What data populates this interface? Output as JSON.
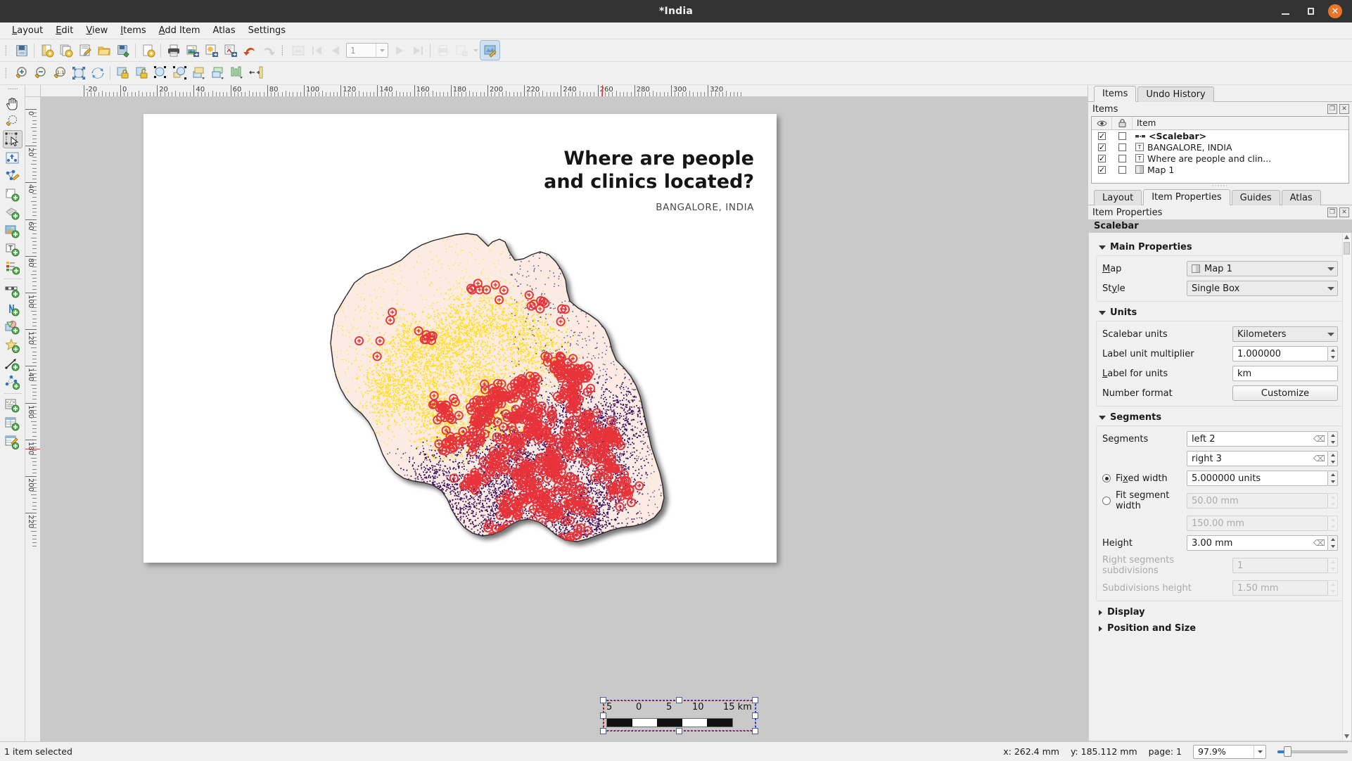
{
  "window": {
    "title": "*India",
    "minimize": "minimize",
    "maximize": "maximize",
    "close": "close"
  },
  "menubar": {
    "items": [
      {
        "label": "Layout",
        "mnemonic": "L"
      },
      {
        "label": "Edit",
        "mnemonic": "E"
      },
      {
        "label": "View",
        "mnemonic": "V"
      },
      {
        "label": "Items",
        "mnemonic": "I"
      },
      {
        "label": "Add Item",
        "mnemonic": "A"
      },
      {
        "label": "Atlas",
        "mnemonic": "A"
      },
      {
        "label": "Settings",
        "mnemonic": "S"
      }
    ]
  },
  "toolbar_layout": {
    "buttons": [
      {
        "name": "save-project-icon",
        "tip": "Save Project"
      },
      {
        "name": "new-layout-icon",
        "tip": "New Layout"
      },
      {
        "name": "duplicate-layout-icon",
        "tip": "Duplicate Layout"
      },
      {
        "name": "layout-manager-icon",
        "tip": "Layout Manager"
      },
      {
        "name": "open-folder-icon",
        "tip": "Layouts"
      },
      {
        "name": "save-layout-icon",
        "tip": "Save as Template"
      },
      {
        "name": "add-pages-icon",
        "tip": "Layout Properties"
      },
      {
        "name": "print-icon",
        "tip": "Print Layout"
      },
      {
        "name": "export-image-icon",
        "tip": "Export as Image"
      },
      {
        "name": "export-svg-icon",
        "tip": "Export as SVG"
      },
      {
        "name": "export-pdf-icon",
        "tip": "Export as PDF"
      },
      {
        "name": "undo-icon",
        "tip": "Undo"
      },
      {
        "name": "redo-icon",
        "tip": "Redo"
      }
    ],
    "atlas_buttons": [
      {
        "name": "atlas-preview-icon",
        "tip": "Preview Atlas"
      },
      {
        "name": "atlas-first-icon",
        "tip": "First feature"
      },
      {
        "name": "atlas-prev-icon",
        "tip": "Previous feature"
      },
      {
        "name": "atlas-next-icon",
        "tip": "Next feature"
      },
      {
        "name": "atlas-last-icon",
        "tip": "Last feature"
      },
      {
        "name": "atlas-print-icon",
        "tip": "Print Atlas"
      },
      {
        "name": "atlas-export-icon",
        "tip": "Export Atlas"
      },
      {
        "name": "atlas-settings-icon",
        "tip": "Atlas Settings"
      }
    ],
    "atlas_page_value": "1"
  },
  "toolbar_nav": {
    "buttons": [
      {
        "name": "zoom-in-icon",
        "tip": "Zoom In"
      },
      {
        "name": "zoom-out-icon",
        "tip": "Zoom Out"
      },
      {
        "name": "zoom-100-icon",
        "tip": "Zoom to 100%"
      },
      {
        "name": "zoom-full-icon",
        "tip": "Zoom Full"
      },
      {
        "name": "refresh-icon",
        "tip": "Refresh View"
      },
      {
        "name": "lock-items-icon",
        "tip": "Lock Selected Items"
      },
      {
        "name": "unlock-items-icon",
        "tip": "Unlock All Items"
      },
      {
        "name": "group-items-icon",
        "tip": "Group Items"
      },
      {
        "name": "ungroup-items-icon",
        "tip": "Ungroup Items"
      },
      {
        "name": "raise-items-icon",
        "tip": "Raise Selected Items"
      },
      {
        "name": "lower-items-icon",
        "tip": "Lower Selected Items"
      },
      {
        "name": "align-left-icon",
        "tip": "Align Left"
      },
      {
        "name": "distribute-icon",
        "tip": "Distribute Items"
      }
    ]
  },
  "left_toolbar": {
    "buttons": [
      {
        "name": "pan-tool-icon",
        "tip": "Pan Layout",
        "active": false
      },
      {
        "name": "zoom-tool-icon",
        "tip": "Zoom",
        "active": false
      },
      {
        "name": "select-items-icon",
        "tip": "Select/Move Item",
        "active": true
      },
      {
        "name": "move-item-content-icon",
        "tip": "Move Item Content",
        "active": false
      },
      {
        "name": "edit-nodes-icon",
        "tip": "Edit Nodes Item",
        "active": false
      },
      {
        "name": "add-map-icon",
        "tip": "Add Map",
        "active": false
      },
      {
        "name": "add-3d-map-icon",
        "tip": "Add 3D Map",
        "active": false
      },
      {
        "name": "add-picture-icon",
        "tip": "Add Picture",
        "active": false
      },
      {
        "name": "add-label-icon",
        "tip": "Add Label",
        "active": false
      },
      {
        "name": "add-legend-icon",
        "tip": "Add Legend",
        "active": false
      },
      {
        "name": "add-scalebar-icon",
        "tip": "Add Scale Bar",
        "active": false
      },
      {
        "name": "add-north-arrow-icon",
        "tip": "Add North Arrow",
        "active": false
      },
      {
        "name": "add-shape-icon",
        "tip": "Add Shape",
        "active": false
      },
      {
        "name": "add-marker-icon",
        "tip": "Add Marker",
        "active": false
      },
      {
        "name": "add-arrow-icon",
        "tip": "Add Arrow",
        "active": false
      },
      {
        "name": "add-node-item-icon",
        "tip": "Add Node Item",
        "active": false
      },
      {
        "name": "add-html-icon",
        "tip": "Add HTML",
        "active": false
      },
      {
        "name": "add-table-icon",
        "tip": "Add Attribute Table",
        "active": false
      },
      {
        "name": "add-manual-table-icon",
        "tip": "Add Fixed Table",
        "active": false
      }
    ]
  },
  "rulers": {
    "horizontal_labels": [
      "-20",
      "0",
      "20",
      "40",
      "60",
      "80",
      "100",
      "120",
      "140",
      "160",
      "180",
      "200",
      "220",
      "240",
      "260",
      "280",
      "300",
      "320"
    ],
    "vertical_labels": [
      "0",
      "20",
      "40",
      "60",
      "80",
      "100",
      "120",
      "140",
      "160",
      "180",
      "200",
      "220"
    ],
    "units": "mm"
  },
  "page_canvas": {
    "title_text": "Where are people\nand clinics located?",
    "subtitle_text": "BANGALORE, INDIA",
    "scalebar": {
      "labels": [
        "5",
        "0",
        "5",
        "10",
        "15 km"
      ],
      "segments": 5
    }
  },
  "right_panel": {
    "top_tabs": [
      {
        "label": "Items",
        "selected": true
      },
      {
        "label": "Undo History",
        "selected": false
      }
    ],
    "items_dock": {
      "title": "Items",
      "columns": [
        "visibility-eye",
        "lock",
        "Item"
      ],
      "column_item_label": "Item",
      "rows": [
        {
          "visible": true,
          "locked": false,
          "icon": "scalebar-icon",
          "label": "<Scalebar>",
          "selected": true
        },
        {
          "visible": true,
          "locked": false,
          "icon": "label-icon",
          "label": "BANGALORE, INDIA",
          "selected": false
        },
        {
          "visible": true,
          "locked": false,
          "icon": "label-icon",
          "label": "Where are people and clin...",
          "selected": false
        },
        {
          "visible": true,
          "locked": false,
          "icon": "map-icon",
          "label": "Map 1",
          "selected": false
        }
      ]
    },
    "bottom_tabs": [
      {
        "label": "Layout",
        "selected": false
      },
      {
        "label": "Item Properties",
        "selected": true
      },
      {
        "label": "Guides",
        "selected": false
      },
      {
        "label": "Atlas",
        "selected": false
      }
    ],
    "properties_dock_title": "Item Properties",
    "item_type_header": "Scalebar",
    "sections": {
      "main_properties": {
        "title": "Main Properties",
        "expanded": true,
        "map_label": "Map",
        "map_mnemonic": "M",
        "map_value": "Map 1",
        "style_label": "Style",
        "style_mnemonic": "y",
        "style_value": "Single Box"
      },
      "units": {
        "title": "Units",
        "expanded": true,
        "scalebar_units_label": "Scalebar units",
        "scalebar_units_value": "Kilometers",
        "label_unit_multiplier_label": "Label unit multiplier",
        "label_unit_multiplier_value": "1.000000",
        "label_for_units_label": "Label for units",
        "label_for_units_mnemonic": "L",
        "label_for_units_value": "km",
        "number_format_label": "Number format",
        "number_format_button": "Customize"
      },
      "segments": {
        "title": "Segments",
        "expanded": true,
        "segments_label": "Segments",
        "segments_left_value": "left 2",
        "segments_right_value": "right 3",
        "fixed_width_label": "Fixed width",
        "fixed_width_mnemonic": "x",
        "fixed_width_selected": true,
        "fixed_width_value": "5.000000 units",
        "fit_segment_width_label": "Fit segment width",
        "fit_segment_width_selected": false,
        "fit_segment_min_value": "50.00 mm",
        "fit_segment_max_value": "150.00 mm",
        "height_label": "Height",
        "height_value": "3.00 mm",
        "right_subdivisions_label": "Right segments subdivisions",
        "right_subdivisions_value": "1",
        "subdivisions_height_label": "Subdivisions height",
        "subdivisions_height_value": "1.50 mm"
      },
      "display": {
        "title": "Display",
        "expanded": false
      },
      "position_and_size": {
        "title": "Position and Size",
        "expanded": false
      }
    }
  },
  "statusbar": {
    "message": "1 item selected",
    "x_readout": "x: 262.4 mm",
    "y_readout": "y: 185.112 mm",
    "page_readout": "page: 1",
    "zoom_value": "97.9%"
  },
  "colors": {
    "titlebar_bg": "#333333",
    "close_button": "#e8752a",
    "panel_bg": "#f0f0f0",
    "canvas_bg": "#c9c9c9",
    "selection_red": "#cc2222",
    "selection_blue": "#2030c8",
    "map_land": "#fcebe2",
    "clinic_red": "#e8333a",
    "pop_yellow": "#ffdf1b",
    "pop_purple": "#3c0f61"
  }
}
